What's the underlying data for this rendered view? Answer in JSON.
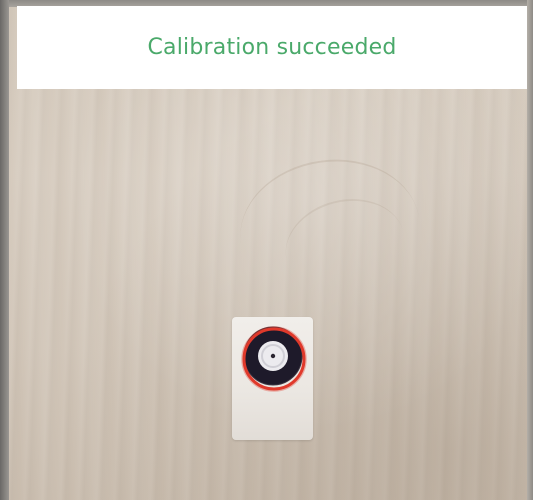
{
  "status": {
    "message": "Calibration succeeded",
    "color": "#4aa96a"
  },
  "camera": {
    "scene": "wood-door-surface"
  },
  "marker": {
    "state": "detected",
    "ring_color": "#e0392b",
    "target_color": "#1e1a2a"
  }
}
